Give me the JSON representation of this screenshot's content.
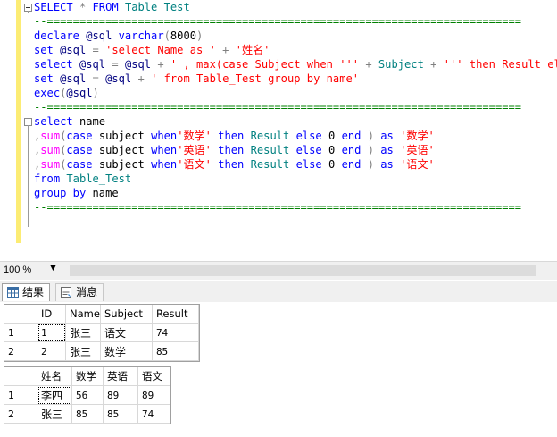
{
  "editor": {
    "lines": [
      [
        [
          "kw",
          "SELECT "
        ],
        [
          "op",
          "* "
        ],
        [
          "kw",
          "FROM "
        ],
        [
          "id",
          "Table_Test"
        ]
      ],
      [
        [
          "cm",
          "--========================================================================="
        ]
      ],
      [
        [
          "kw",
          "declare "
        ],
        [
          "var",
          "@sql "
        ],
        [
          "kw",
          "varchar"
        ],
        [
          "op",
          "("
        ],
        [
          "txt",
          "8000"
        ],
        [
          "op",
          ")"
        ]
      ],
      [
        [
          "kw",
          "set "
        ],
        [
          "var",
          "@sql "
        ],
        [
          "op",
          "= "
        ],
        [
          "str",
          "'select Name as ' "
        ],
        [
          "op",
          "+ "
        ],
        [
          "str",
          "'姓名'"
        ]
      ],
      [
        [
          "kw",
          "select "
        ],
        [
          "var",
          "@sql "
        ],
        [
          "op",
          "= "
        ],
        [
          "var",
          "@sql "
        ],
        [
          "op",
          "+ "
        ],
        [
          "str",
          "' , max(case Subject when ''' "
        ],
        [
          "op",
          "+ "
        ],
        [
          "id",
          "Subject "
        ],
        [
          "op",
          "+ "
        ],
        [
          "str",
          "''' then Result else"
        ]
      ],
      [
        [
          "kw",
          "set "
        ],
        [
          "var",
          "@sql "
        ],
        [
          "op",
          "= "
        ],
        [
          "var",
          "@sql "
        ],
        [
          "op",
          "+ "
        ],
        [
          "str",
          "' from Table_Test group by name'"
        ]
      ],
      [
        [
          "kw",
          "exec"
        ],
        [
          "op",
          "("
        ],
        [
          "var",
          "@sql"
        ],
        [
          "op",
          ")"
        ]
      ],
      [
        [
          "cm",
          "--========================================================================="
        ]
      ],
      [
        [
          "kw",
          "select "
        ],
        [
          "txt",
          "name"
        ]
      ],
      [
        [
          "op",
          ","
        ],
        [
          "fn",
          "sum"
        ],
        [
          "op",
          "("
        ],
        [
          "kw",
          "case "
        ],
        [
          "txt",
          "subject "
        ],
        [
          "kw",
          "when"
        ],
        [
          "str",
          "'数学' "
        ],
        [
          "kw",
          "then "
        ],
        [
          "id",
          "Result "
        ],
        [
          "kw",
          "else "
        ],
        [
          "txt",
          "0 "
        ],
        [
          "kw",
          "end "
        ],
        [
          "op",
          ") "
        ],
        [
          "kw",
          "as "
        ],
        [
          "str",
          "'数学'"
        ]
      ],
      [
        [
          "op",
          ","
        ],
        [
          "fn",
          "sum"
        ],
        [
          "op",
          "("
        ],
        [
          "kw",
          "case "
        ],
        [
          "txt",
          "subject "
        ],
        [
          "kw",
          "when"
        ],
        [
          "str",
          "'英语' "
        ],
        [
          "kw",
          "then "
        ],
        [
          "id",
          "Result "
        ],
        [
          "kw",
          "else "
        ],
        [
          "txt",
          "0 "
        ],
        [
          "kw",
          "end "
        ],
        [
          "op",
          ") "
        ],
        [
          "kw",
          "as "
        ],
        [
          "str",
          "'英语'"
        ]
      ],
      [
        [
          "op",
          ","
        ],
        [
          "fn",
          "sum"
        ],
        [
          "op",
          "("
        ],
        [
          "kw",
          "case "
        ],
        [
          "txt",
          "subject "
        ],
        [
          "kw",
          "when"
        ],
        [
          "str",
          "'语文' "
        ],
        [
          "kw",
          "then "
        ],
        [
          "id",
          "Result "
        ],
        [
          "kw",
          "else "
        ],
        [
          "txt",
          "0 "
        ],
        [
          "kw",
          "end "
        ],
        [
          "op",
          ") "
        ],
        [
          "kw",
          "as "
        ],
        [
          "str",
          "'语文'"
        ]
      ],
      [
        [
          "kw",
          "from "
        ],
        [
          "id",
          "Table_Test"
        ]
      ],
      [
        [
          "kw",
          "group by "
        ],
        [
          "txt",
          "name"
        ]
      ],
      [
        [
          "cm",
          "--========================================================================="
        ]
      ]
    ]
  },
  "colors": {
    "keyword": "#0000ff",
    "string": "#ff0000",
    "function": "#ff00ff",
    "variable": "#000080",
    "identifier": "#008080",
    "comment": "#008000",
    "margin": "#fcec74"
  },
  "zoom": {
    "value": "100 %"
  },
  "tabs": [
    {
      "label": "结果",
      "icon": "grid-icon",
      "active": true
    },
    {
      "label": "消息",
      "icon": "message-icon",
      "active": false
    }
  ],
  "grid1": {
    "columns": [
      "ID",
      "Name",
      "Subject",
      "Result"
    ],
    "rows": [
      {
        "num": "1",
        "cells": [
          "1",
          "张三",
          "语文",
          "74"
        ]
      },
      {
        "num": "2",
        "cells": [
          "2",
          "张三",
          "数学",
          "85"
        ]
      }
    ]
  },
  "grid2": {
    "columns": [
      "姓名",
      "数学",
      "英语",
      "语文"
    ],
    "rows": [
      {
        "num": "1",
        "cells": [
          "李四",
          "56",
          "89",
          "89"
        ]
      },
      {
        "num": "2",
        "cells": [
          "张三",
          "85",
          "85",
          "74"
        ]
      }
    ]
  }
}
